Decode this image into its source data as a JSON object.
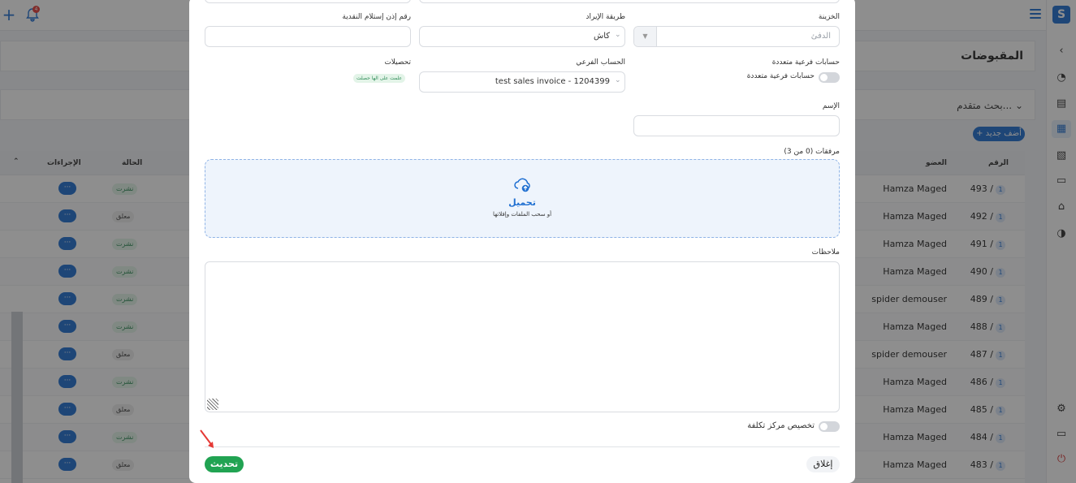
{
  "page": {
    "title": "المقبوضات",
    "advanced_search": "بحث متقدم...",
    "add_new": "+ أضف جديد",
    "notification_count": "4"
  },
  "table": {
    "headers": {
      "number": "الرقم",
      "member": "العضو",
      "status": "الحالة",
      "actions": "الإجراءات"
    },
    "rows": [
      {
        "number": "493 /",
        "member": "Hamza Maged",
        "status": "نشرت",
        "kind": "pub"
      },
      {
        "number": "492 /",
        "member": "Hamza Maged",
        "status": "معلق",
        "kind": "hold"
      },
      {
        "number": "491 /",
        "member": "Hamza Maged",
        "status": "نشرت",
        "kind": "pub"
      },
      {
        "number": "490 /",
        "member": "Hamza Maged",
        "status": "نشرت",
        "kind": "pub"
      },
      {
        "number": "489 /",
        "member": "spider demouser",
        "status": "نشرت",
        "kind": "pub"
      },
      {
        "number": "488 /",
        "member": "Hamza Maged",
        "status": "نشرت",
        "kind": "pub"
      },
      {
        "number": "487 /",
        "member": "spider demouser",
        "status": "معلق",
        "kind": "hold"
      },
      {
        "number": "486 /",
        "member": "Hamza Maged",
        "status": "نشرت",
        "kind": "pub"
      },
      {
        "number": "485 /",
        "member": "Hamza Maged",
        "status": "معلق",
        "kind": "hold"
      },
      {
        "number": "484 /",
        "member": "Hamza Maged",
        "status": "نشرت",
        "kind": "pub"
      },
      {
        "number": "483 /",
        "member": "Hamza Maged",
        "status": "معلق",
        "kind": "hold"
      }
    ],
    "row_badge": "1",
    "actions_label": "···"
  },
  "modal": {
    "treasury_label": "الخزينة",
    "treasury_placeholder": "الدفئ",
    "income_method_label": "طريقة الإيراد",
    "income_method_value": "كاش",
    "cash_receipt_label": "رقم إذن إستلام النقدية",
    "multi_sub_label": "حسابات فرعية متعددة",
    "multi_sub_toggle_label": "حسابات فرعية متعددة",
    "sub_account_label": "الحساب الفرعي",
    "sub_account_value": "test sales invoice - 1204399",
    "collections_label": "تحصيلات",
    "collections_badge": "علمت على الها حصلت",
    "name_label": "الإسم",
    "attachments_label": "مرفقات (0 من 3)",
    "upload_title": "تحميل",
    "upload_sub": "أو سحب الملفات وإفلاتها",
    "notes_label": "ملاحظات",
    "cost_center_label": "تخصيص مركز تكلفة",
    "update_button": "تحديث",
    "close_button": "إغلاق"
  },
  "colors": {
    "accent": "#1f6fd1",
    "success": "#21a352",
    "danger": "#e53935"
  }
}
